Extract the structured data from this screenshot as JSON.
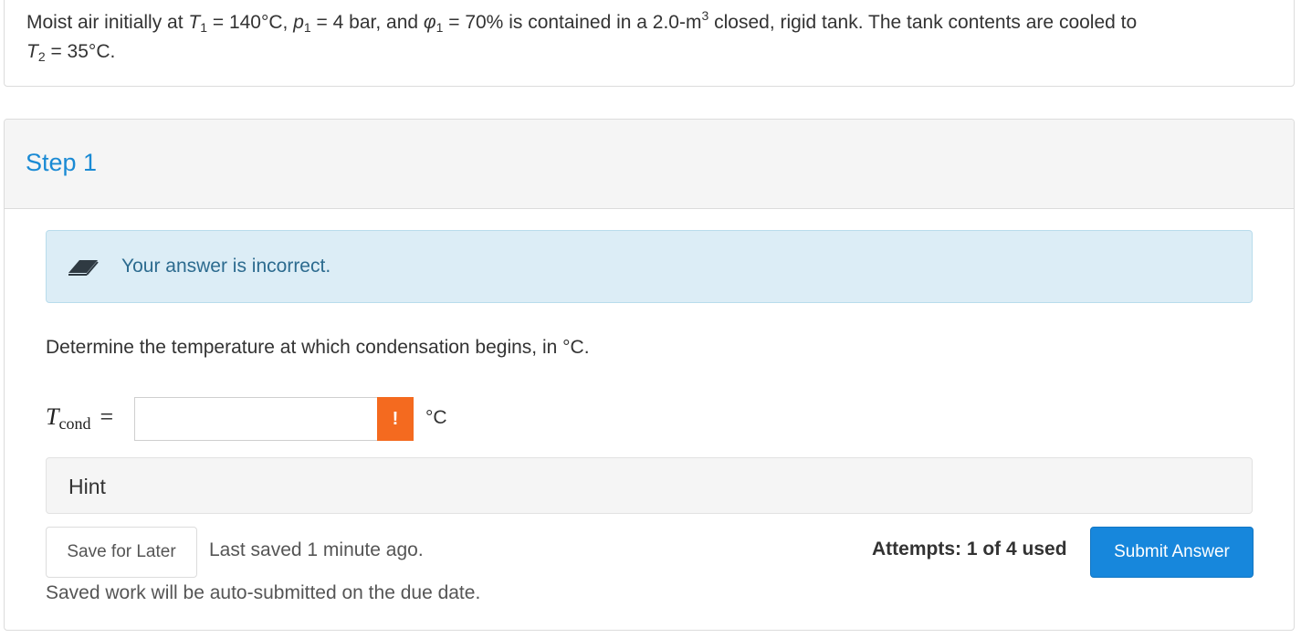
{
  "problem": {
    "line1": {
      "t1_intro": "Moist air initially at ",
      "t1_sym": "T",
      "t1_sub": "1",
      "t1_val": " = 140°C, ",
      "p1_sym": "p",
      "p1_sub": "1",
      "p1_val": " = 4 bar, and ",
      "phi_sym": "φ",
      "phi_sub": "1",
      "phi_val": " = 70% is contained in a 2.0-m",
      "sup": "3",
      "rest": " closed, rigid tank. The tank contents are cooled to"
    },
    "line2": {
      "t2_sym": "T",
      "t2_sub": "2",
      "t2_val": " = 35°C."
    }
  },
  "step": {
    "title": "Step 1",
    "alert": "Your answer is incorrect.",
    "question": "Determine the temperature at which condensation begins, in °C.",
    "variable": {
      "symbol": "T",
      "subscript": "cond",
      "equals": "="
    },
    "answer_value": "",
    "warning_glyph": "!",
    "unit": "°C",
    "hint_label": "Hint",
    "save_label": "Save for Later",
    "last_saved": "Last saved 1 minute ago.",
    "autosubmit_note": "Saved work will be auto-submitted on the due date.",
    "attempts": "Attempts: 1 of 4 used",
    "submit_label": "Submit Answer"
  },
  "colors": {
    "accent_blue": "#1a8ad4",
    "submit_blue": "#1787dc",
    "alert_bg": "#dcedf6",
    "warning_orange": "#f46a1f"
  },
  "icons": {
    "alert_icon": "eraser-icon",
    "warning_icon": "exclamation-icon"
  }
}
